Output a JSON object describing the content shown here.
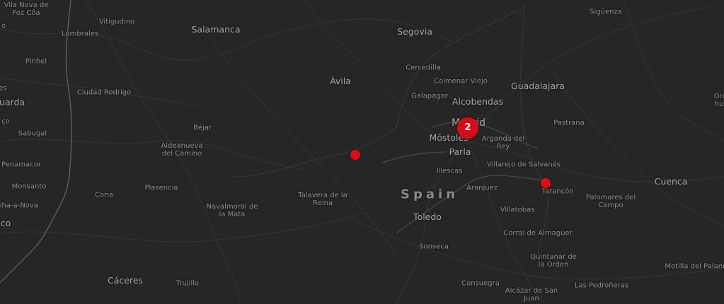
{
  "map": {
    "country_label": "Spain",
    "place_labels": [
      {
        "id": "vila-nova-de-foz-coa",
        "text": "Vila Nova de\nFoz Côa",
        "rank": "town"
      },
      {
        "id": "vitigudino",
        "text": "Vitigudino",
        "rank": "town"
      },
      {
        "id": "lumbrales",
        "text": "Lumbrales",
        "rank": "town"
      },
      {
        "id": "salamanca",
        "text": "Salamanca",
        "rank": "city"
      },
      {
        "id": "segovia",
        "text": "Segovia",
        "rank": "city"
      },
      {
        "id": "siguenza",
        "text": "Sigüenza",
        "rank": "town"
      },
      {
        "id": "pinhel",
        "text": "Pinhel",
        "rank": "town"
      },
      {
        "id": "cercedilla",
        "text": "Cercedilla",
        "rank": "town"
      },
      {
        "id": "avila",
        "text": "Ávila",
        "rank": "city"
      },
      {
        "id": "colmenar-viejo",
        "text": "Colmenar Viejo",
        "rank": "town"
      },
      {
        "id": "guadalajara",
        "text": "Guadalajara",
        "rank": "city"
      },
      {
        "id": "ciudad-rodrigo",
        "text": "Ciudad Rodrigo",
        "rank": "town"
      },
      {
        "id": "galapagar",
        "text": "Galapagar",
        "rank": "town"
      },
      {
        "id": "alcobendas",
        "text": "Alcobendas",
        "rank": "city"
      },
      {
        "id": "guarda",
        "text": "uarda",
        "rank": "city"
      },
      {
        "id": "madrid",
        "text": "Madrid",
        "rank": "city"
      },
      {
        "id": "pastrana",
        "text": "Pastrana",
        "rank": "town"
      },
      {
        "id": "bejar",
        "text": "Béjar",
        "rank": "town"
      },
      {
        "id": "sabugal",
        "text": "Sabugal",
        "rank": "town"
      },
      {
        "id": "mostoles",
        "text": "Móstoles",
        "rank": "city"
      },
      {
        "id": "arganda-del-rey",
        "text": "Arganda del\nRey",
        "rank": "town"
      },
      {
        "id": "aldeanueva-del-camino",
        "text": "Aldeanueva\ndel Camino",
        "rank": "town"
      },
      {
        "id": "parla",
        "text": "Parla",
        "rank": "city"
      },
      {
        "id": "villarejo-de-salvanes",
        "text": "Villarejo de Salvanés",
        "rank": "town"
      },
      {
        "id": "penamacor",
        "text": "Penamacor",
        "rank": "town"
      },
      {
        "id": "illescas",
        "text": "Illescas",
        "rank": "town"
      },
      {
        "id": "cuenca",
        "text": "Cuenca",
        "rank": "city"
      },
      {
        "id": "monsanto",
        "text": "Monsanto",
        "rank": "town"
      },
      {
        "id": "plasencia",
        "text": "Plasencia",
        "rank": "town"
      },
      {
        "id": "talavera-de-la-reina",
        "text": "Talavera de la\nReina",
        "rank": "town"
      },
      {
        "id": "aranjuez",
        "text": "Aranjuez",
        "rank": "town"
      },
      {
        "id": "tarancon",
        "text": "Tarancón",
        "rank": "town"
      },
      {
        "id": "coria",
        "text": "Coria",
        "rank": "town"
      },
      {
        "id": "palomares-del-campo",
        "text": "Palomares del\nCampo",
        "rank": "town"
      },
      {
        "id": "idanha-a-nova",
        "text": "nha-a-Nova",
        "rank": "town"
      },
      {
        "id": "navalmoral-de-la-mata",
        "text": "Navalmoral de\nla Mata",
        "rank": "town"
      },
      {
        "id": "villatobas",
        "text": "Villatobas",
        "rank": "town"
      },
      {
        "id": "toledo",
        "text": "Toledo",
        "rank": "city"
      },
      {
        "id": "co",
        "text": "co",
        "rank": "city"
      },
      {
        "id": "corral-de-almaguer",
        "text": "Corral de Almaguer",
        "rank": "town"
      },
      {
        "id": "sonseca",
        "text": "Sonseca",
        "rank": "town"
      },
      {
        "id": "quintanar-de-la-orden",
        "text": "Quintanar de\nla Orden",
        "rank": "town"
      },
      {
        "id": "motilla-del-palancar",
        "text": "Motilla del Palanca",
        "rank": "town"
      },
      {
        "id": "caceres",
        "text": "Cáceres",
        "rank": "city"
      },
      {
        "id": "trujillo",
        "text": "Trujillo",
        "rank": "town"
      },
      {
        "id": "consuegra",
        "text": "Consuegra",
        "rank": "town"
      },
      {
        "id": "las-pedroneras",
        "text": "Las Pedroñeras",
        "rank": "town"
      },
      {
        "id": "alcazar-de-san-juan",
        "text": "Alcázar de San\nJuan",
        "rank": "town"
      },
      {
        "id": "orihuela-edge",
        "text": "Ori\nhu",
        "rank": "town"
      },
      {
        "id": "ticked-edge",
        "text": "ço",
        "rank": "town"
      },
      {
        "id": "edge-es",
        "text": "es",
        "rank": "town"
      },
      {
        "id": "edge-o",
        "text": "o",
        "rank": "town"
      }
    ],
    "cluster": {
      "count": "2",
      "color": "#cf0f1b"
    },
    "markers": [
      {
        "id": "marker-talavera-area",
        "color": "#d7101c"
      },
      {
        "id": "marker-tarancon",
        "color": "#d7101c"
      }
    ],
    "colors": {
      "background": "#262626",
      "roads": "#3a3a3a",
      "border": "#555555"
    }
  }
}
